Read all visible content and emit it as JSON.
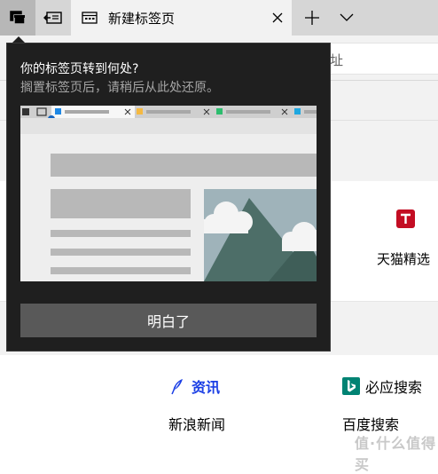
{
  "tab_bar": {
    "active_tab_title": "新建标签页",
    "colors": {
      "bar": "#d6d6d6",
      "active_tab": "#f2f2f2",
      "aside_button": "#b7b7b7"
    }
  },
  "address_bar": {
    "placeholder_partial": "址"
  },
  "top_sites": [
    {
      "label": "天猫精选",
      "icon": "tmall-icon",
      "color": "#c30d23",
      "icon_letter": "T"
    }
  ],
  "news": {
    "sections": [
      {
        "title": "资讯",
        "icon": "news-feather-icon",
        "color": "#1a3ee5"
      },
      {
        "title": "必应搜索",
        "icon": "bing-icon",
        "color": "#008373"
      }
    ],
    "links": [
      "新浪新闻",
      "百度搜索"
    ]
  },
  "teaching_tip": {
    "title": "你的标签页转到何处?",
    "subtitle": "搁置标签页后，请稍后从此处还原。",
    "button_label": "明白了",
    "colors": {
      "background": "#1f1f1f",
      "button": "#595959"
    }
  },
  "watermark": "值·什么值得买"
}
